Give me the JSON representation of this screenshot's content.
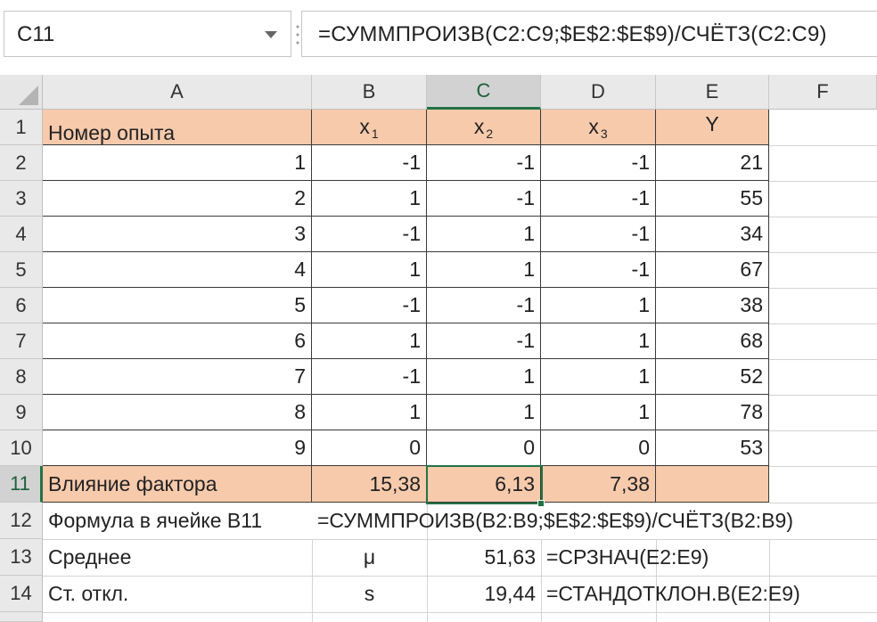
{
  "name_box": {
    "value": "C11"
  },
  "formula_bar": {
    "value": "=СУММПРОИЗВ(C2:C9;$E$2:$E$9)/СЧЁТЗ(C2:C9)"
  },
  "columns": [
    "A",
    "B",
    "C",
    "D",
    "E",
    "F"
  ],
  "rows": [
    "1",
    "2",
    "3",
    "4",
    "5",
    "6",
    "7",
    "8",
    "9",
    "10",
    "11",
    "12",
    "13",
    "14"
  ],
  "header_row": {
    "a": "Номер опыта",
    "b_base": "x",
    "b_sub": "1",
    "c_base": "x",
    "c_sub": "2",
    "d_base": "x",
    "d_sub": "3",
    "e": "Y"
  },
  "data_rows": [
    [
      "1",
      "-1",
      "-1",
      "-1",
      "21"
    ],
    [
      "2",
      "1",
      "-1",
      "-1",
      "55"
    ],
    [
      "3",
      "-1",
      "1",
      "-1",
      "34"
    ],
    [
      "4",
      "1",
      "1",
      "-1",
      "67"
    ],
    [
      "5",
      "-1",
      "-1",
      "1",
      "38"
    ],
    [
      "6",
      "1",
      "-1",
      "1",
      "68"
    ],
    [
      "7",
      "-1",
      "1",
      "1",
      "52"
    ],
    [
      "8",
      "1",
      "1",
      "1",
      "78"
    ],
    [
      "9",
      "0",
      "0",
      "0",
      "53"
    ]
  ],
  "row11": {
    "a": "Влияние фактора",
    "b": "15,38",
    "c": "6,13",
    "d": "7,38"
  },
  "row12": {
    "a": "Формула в ячейке B11",
    "b": "=СУММПРОИЗВ(B2:B9;$E$2:$E$9)/СЧЁТЗ(B2:B9)"
  },
  "row13": {
    "a": "Среднее",
    "b": "μ",
    "c": "51,63",
    "d": "=СРЗНАЧ(E2:E9)"
  },
  "row14": {
    "a": "Ст. откл.",
    "b": "s",
    "c": "19,44",
    "d": "=СТАНДОТКЛОН.В(E2:E9)"
  },
  "colors": {
    "header_fill": "#f7caac",
    "selection": "#217346"
  }
}
